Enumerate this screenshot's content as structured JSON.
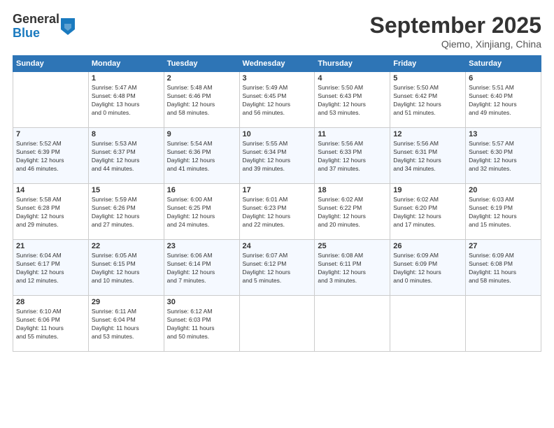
{
  "logo": {
    "general": "General",
    "blue": "Blue"
  },
  "header": {
    "month": "September 2025",
    "location": "Qiemo, Xinjiang, China"
  },
  "weekdays": [
    "Sunday",
    "Monday",
    "Tuesday",
    "Wednesday",
    "Thursday",
    "Friday",
    "Saturday"
  ],
  "weeks": [
    [
      {
        "day": "",
        "info": ""
      },
      {
        "day": "1",
        "info": "Sunrise: 5:47 AM\nSunset: 6:48 PM\nDaylight: 13 hours\nand 0 minutes."
      },
      {
        "day": "2",
        "info": "Sunrise: 5:48 AM\nSunset: 6:46 PM\nDaylight: 12 hours\nand 58 minutes."
      },
      {
        "day": "3",
        "info": "Sunrise: 5:49 AM\nSunset: 6:45 PM\nDaylight: 12 hours\nand 56 minutes."
      },
      {
        "day": "4",
        "info": "Sunrise: 5:50 AM\nSunset: 6:43 PM\nDaylight: 12 hours\nand 53 minutes."
      },
      {
        "day": "5",
        "info": "Sunrise: 5:50 AM\nSunset: 6:42 PM\nDaylight: 12 hours\nand 51 minutes."
      },
      {
        "day": "6",
        "info": "Sunrise: 5:51 AM\nSunset: 6:40 PM\nDaylight: 12 hours\nand 49 minutes."
      }
    ],
    [
      {
        "day": "7",
        "info": "Sunrise: 5:52 AM\nSunset: 6:39 PM\nDaylight: 12 hours\nand 46 minutes."
      },
      {
        "day": "8",
        "info": "Sunrise: 5:53 AM\nSunset: 6:37 PM\nDaylight: 12 hours\nand 44 minutes."
      },
      {
        "day": "9",
        "info": "Sunrise: 5:54 AM\nSunset: 6:36 PM\nDaylight: 12 hours\nand 41 minutes."
      },
      {
        "day": "10",
        "info": "Sunrise: 5:55 AM\nSunset: 6:34 PM\nDaylight: 12 hours\nand 39 minutes."
      },
      {
        "day": "11",
        "info": "Sunrise: 5:56 AM\nSunset: 6:33 PM\nDaylight: 12 hours\nand 37 minutes."
      },
      {
        "day": "12",
        "info": "Sunrise: 5:56 AM\nSunset: 6:31 PM\nDaylight: 12 hours\nand 34 minutes."
      },
      {
        "day": "13",
        "info": "Sunrise: 5:57 AM\nSunset: 6:30 PM\nDaylight: 12 hours\nand 32 minutes."
      }
    ],
    [
      {
        "day": "14",
        "info": "Sunrise: 5:58 AM\nSunset: 6:28 PM\nDaylight: 12 hours\nand 29 minutes."
      },
      {
        "day": "15",
        "info": "Sunrise: 5:59 AM\nSunset: 6:26 PM\nDaylight: 12 hours\nand 27 minutes."
      },
      {
        "day": "16",
        "info": "Sunrise: 6:00 AM\nSunset: 6:25 PM\nDaylight: 12 hours\nand 24 minutes."
      },
      {
        "day": "17",
        "info": "Sunrise: 6:01 AM\nSunset: 6:23 PM\nDaylight: 12 hours\nand 22 minutes."
      },
      {
        "day": "18",
        "info": "Sunrise: 6:02 AM\nSunset: 6:22 PM\nDaylight: 12 hours\nand 20 minutes."
      },
      {
        "day": "19",
        "info": "Sunrise: 6:02 AM\nSunset: 6:20 PM\nDaylight: 12 hours\nand 17 minutes."
      },
      {
        "day": "20",
        "info": "Sunrise: 6:03 AM\nSunset: 6:19 PM\nDaylight: 12 hours\nand 15 minutes."
      }
    ],
    [
      {
        "day": "21",
        "info": "Sunrise: 6:04 AM\nSunset: 6:17 PM\nDaylight: 12 hours\nand 12 minutes."
      },
      {
        "day": "22",
        "info": "Sunrise: 6:05 AM\nSunset: 6:15 PM\nDaylight: 12 hours\nand 10 minutes."
      },
      {
        "day": "23",
        "info": "Sunrise: 6:06 AM\nSunset: 6:14 PM\nDaylight: 12 hours\nand 7 minutes."
      },
      {
        "day": "24",
        "info": "Sunrise: 6:07 AM\nSunset: 6:12 PM\nDaylight: 12 hours\nand 5 minutes."
      },
      {
        "day": "25",
        "info": "Sunrise: 6:08 AM\nSunset: 6:11 PM\nDaylight: 12 hours\nand 3 minutes."
      },
      {
        "day": "26",
        "info": "Sunrise: 6:09 AM\nSunset: 6:09 PM\nDaylight: 12 hours\nand 0 minutes."
      },
      {
        "day": "27",
        "info": "Sunrise: 6:09 AM\nSunset: 6:08 PM\nDaylight: 11 hours\nand 58 minutes."
      }
    ],
    [
      {
        "day": "28",
        "info": "Sunrise: 6:10 AM\nSunset: 6:06 PM\nDaylight: 11 hours\nand 55 minutes."
      },
      {
        "day": "29",
        "info": "Sunrise: 6:11 AM\nSunset: 6:04 PM\nDaylight: 11 hours\nand 53 minutes."
      },
      {
        "day": "30",
        "info": "Sunrise: 6:12 AM\nSunset: 6:03 PM\nDaylight: 11 hours\nand 50 minutes."
      },
      {
        "day": "",
        "info": ""
      },
      {
        "day": "",
        "info": ""
      },
      {
        "day": "",
        "info": ""
      },
      {
        "day": "",
        "info": ""
      }
    ]
  ]
}
